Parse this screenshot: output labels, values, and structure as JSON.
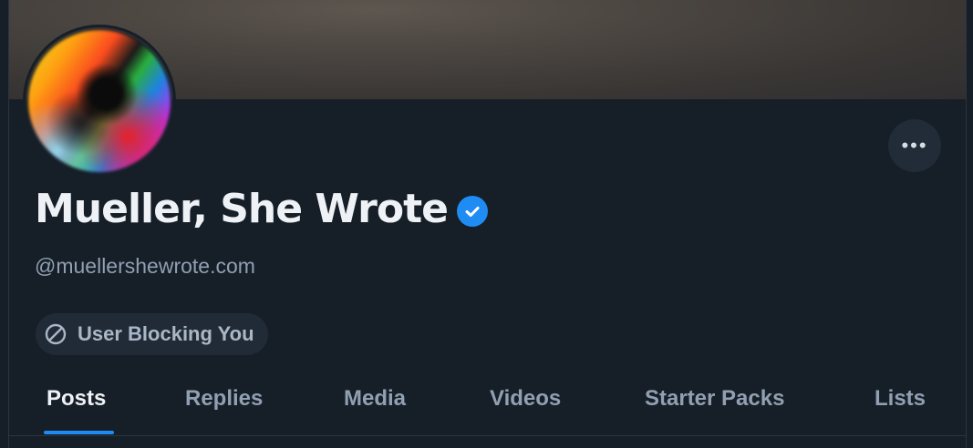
{
  "profile": {
    "display_name": "Mueller, She Wrote",
    "handle": "@muellershewrote.com",
    "verified": true,
    "blocking_label": "User Blocking You"
  },
  "tabs": [
    {
      "label": "Posts",
      "active": true
    },
    {
      "label": "Replies",
      "active": false
    },
    {
      "label": "Media",
      "active": false
    },
    {
      "label": "Videos",
      "active": false
    },
    {
      "label": "Starter Packs",
      "active": false
    },
    {
      "label": "Lists",
      "active": false
    }
  ],
  "actions": {
    "more_label": "•••"
  },
  "colors": {
    "background": "#161e27",
    "accent": "#1f8cf4",
    "muted_text": "#90a0b2"
  }
}
